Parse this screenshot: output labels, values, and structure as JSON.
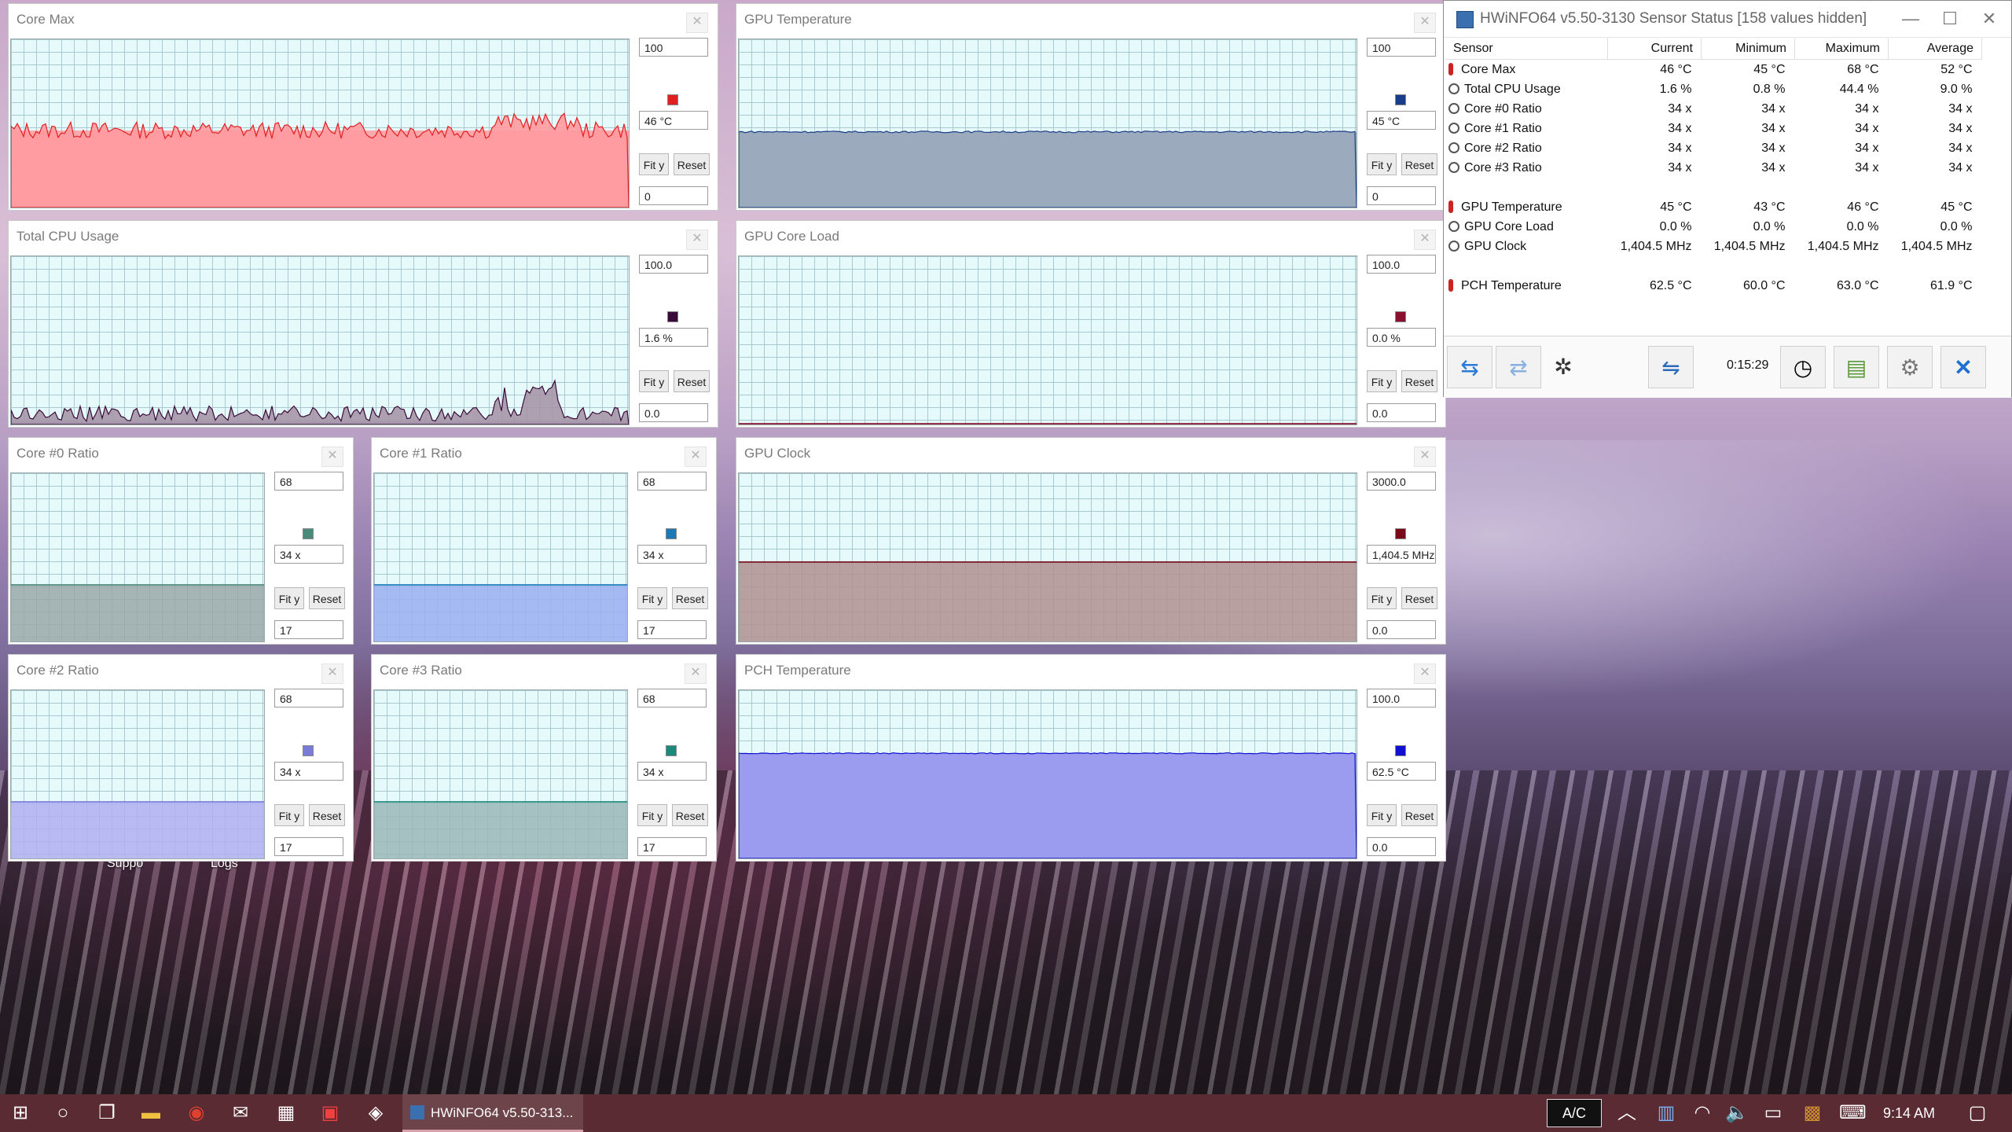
{
  "window": {
    "title": "HWiNFO64 v5.50-3130 Sensor Status [158 values hidden]",
    "minimize": "—",
    "maximize": "☐",
    "close": "✕"
  },
  "table": {
    "headers": [
      "Sensor",
      "Current",
      "Minimum",
      "Maximum",
      "Average"
    ],
    "rows": [
      {
        "icon": "thermometer-icon",
        "name": "Core Max",
        "current": "46 °C",
        "min": "45 °C",
        "max": "68 °C",
        "avg": "52 °C"
      },
      {
        "icon": "gauge-icon",
        "name": "Total CPU Usage",
        "current": "1.6 %",
        "min": "0.8 %",
        "max": "44.4 %",
        "avg": "9.0 %"
      },
      {
        "icon": "gauge-icon",
        "name": "Core #0 Ratio",
        "current": "34 x",
        "min": "34 x",
        "max": "34 x",
        "avg": "34 x"
      },
      {
        "icon": "gauge-icon",
        "name": "Core #1 Ratio",
        "current": "34 x",
        "min": "34 x",
        "max": "34 x",
        "avg": "34 x"
      },
      {
        "icon": "gauge-icon",
        "name": "Core #2 Ratio",
        "current": "34 x",
        "min": "34 x",
        "max": "34 x",
        "avg": "34 x"
      },
      {
        "icon": "gauge-icon",
        "name": "Core #3 Ratio",
        "current": "34 x",
        "min": "34 x",
        "max": "34 x",
        "avg": "34 x"
      },
      {
        "icon": "",
        "name": "",
        "current": "",
        "min": "",
        "max": "",
        "avg": ""
      },
      {
        "icon": "thermometer-icon",
        "name": "GPU Temperature",
        "current": "45 °C",
        "min": "43 °C",
        "max": "46 °C",
        "avg": "45 °C"
      },
      {
        "icon": "gauge-icon",
        "name": "GPU Core Load",
        "current": "0.0 %",
        "min": "0.0 %",
        "max": "0.0 %",
        "avg": "0.0 %"
      },
      {
        "icon": "gauge-icon",
        "name": "GPU Clock",
        "current": "1,404.5 MHz",
        "min": "1,404.5 MHz",
        "max": "1,404.5 MHz",
        "avg": "1,404.5 MHz"
      },
      {
        "icon": "",
        "name": "",
        "current": "",
        "min": "",
        "max": "",
        "avg": ""
      },
      {
        "icon": "thermometer-icon",
        "name": "PCH Temperature",
        "current": "62.5 °C",
        "min": "60.0 °C",
        "max": "63.0 °C",
        "avg": "61.9 °C"
      }
    ]
  },
  "toolbar": {
    "elapsed": "0:15:29"
  },
  "graphs": [
    {
      "id": "core-max",
      "title": "Core Max",
      "top": "100",
      "current": "46 °C",
      "bottom": "0",
      "fit": "Fit y",
      "reset": "Reset",
      "color": "#e02020",
      "fill": "#ff9aa0",
      "level": 0.46,
      "noise": 0.05
    },
    {
      "id": "gpu-temperature",
      "title": "GPU Temperature",
      "top": "100",
      "current": "45 °C",
      "bottom": "0",
      "fit": "Fit y",
      "reset": "Reset",
      "color": "#1a3d8a",
      "fill": "#9aaabb",
      "level": 0.45,
      "noise": 0.005
    },
    {
      "id": "total-cpu-usage",
      "title": "Total CPU Usage",
      "top": "100.0",
      "current": "1.6 %",
      "bottom": "0.0",
      "fit": "Fit y",
      "reset": "Reset",
      "color": "#3a0a3a",
      "fill": "#a596a8",
      "level": 0.02,
      "noise": 0.1
    },
    {
      "id": "gpu-core-load",
      "title": "GPU Core Load",
      "top": "100.0",
      "current": "0.0 %",
      "bottom": "0.0",
      "fit": "Fit y",
      "reset": "Reset",
      "color": "#8a1030",
      "fill": "#c9a0a8",
      "level": 0.0,
      "noise": 0
    },
    {
      "id": "core-0-ratio",
      "title": "Core #0 Ratio",
      "top": "68",
      "current": "34 x",
      "bottom": "17",
      "fit": "Fit y",
      "reset": "Reset",
      "color": "#4a8a7a",
      "fill": "#9aa8a8",
      "level": 0.333,
      "noise": 0
    },
    {
      "id": "core-1-ratio",
      "title": "Core #1 Ratio",
      "top": "68",
      "current": "34 x",
      "bottom": "17",
      "fit": "Fit y",
      "reset": "Reset",
      "color": "#1a7ab8",
      "fill": "#9ab0f0",
      "level": 0.333,
      "noise": 0
    },
    {
      "id": "gpu-clock",
      "title": "GPU Clock",
      "top": "3000.0",
      "current": "1,404.5 MHz",
      "bottom": "0.0",
      "fit": "Fit y",
      "reset": "Reset",
      "color": "#7a0a1a",
      "fill": "#b09090",
      "level": 0.468,
      "noise": 0
    },
    {
      "id": "core-2-ratio",
      "title": "Core #2 Ratio",
      "top": "68",
      "current": "34 x",
      "bottom": "17",
      "fit": "Fit y",
      "reset": "Reset",
      "color": "#7a7ad8",
      "fill": "#b0b0f0",
      "level": 0.333,
      "noise": 0
    },
    {
      "id": "core-3-ratio",
      "title": "Core #3 Ratio",
      "top": "68",
      "current": "34 x",
      "bottom": "17",
      "fit": "Fit y",
      "reset": "Reset",
      "color": "#1a8a7a",
      "fill": "#9ab8b8",
      "level": 0.333,
      "noise": 0
    },
    {
      "id": "pch-temperature",
      "title": "PCH Temperature",
      "top": "100.0",
      "current": "62.5 °C",
      "bottom": "0.0",
      "fit": "Fit y",
      "reset": "Reset",
      "color": "#1010d0",
      "fill": "#9a9af0",
      "level": 0.625,
      "noise": 0.003
    }
  ],
  "desktop": {
    "label1": "Suppo",
    "label2": "Logs"
  },
  "taskbar": {
    "task_label": "HWiNFO64 v5.50-313...",
    "ac_label": "A/C",
    "clock": "9:14 AM"
  }
}
